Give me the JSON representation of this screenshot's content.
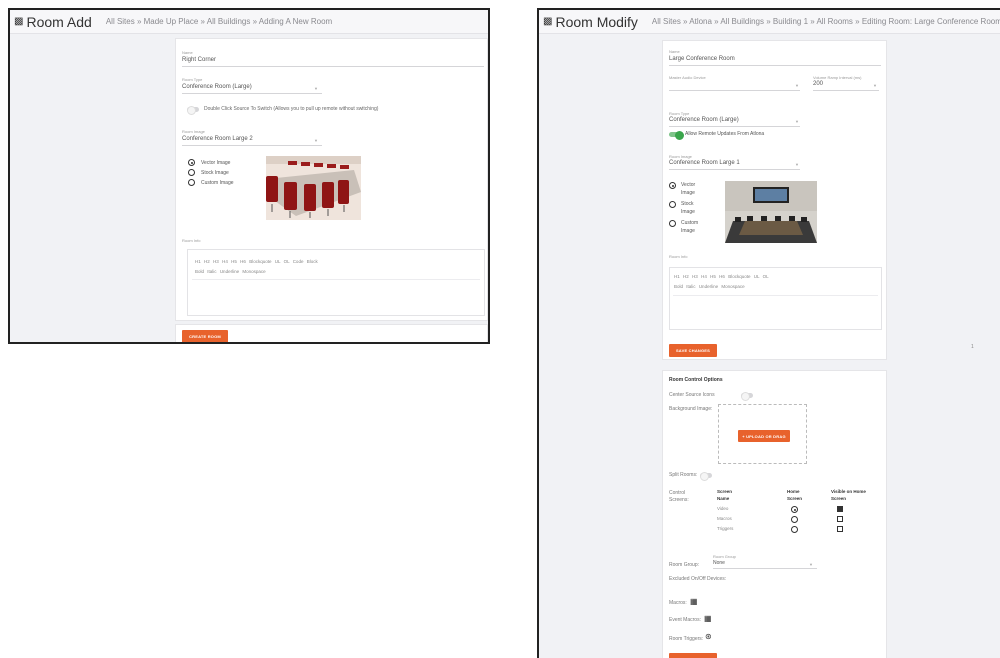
{
  "left": {
    "title": "Room Add",
    "breadcrumb": "All Sites » Made Up Place » All Buildings » Adding A New Room",
    "name_label": "Name",
    "name_value": "Right Corner",
    "room_type_label": "Room Type",
    "room_type_value": "Conference Room (Large)",
    "double_click_label": "Double Click Source To Switch (Allows you to pull up remote without switching)",
    "room_image_label": "Room Image",
    "room_image_value": "Conference Room Large 2",
    "image_options": [
      "Vector Image",
      "Stock Image",
      "Custom Image"
    ],
    "room_info_label": "Room Info",
    "toolbar_row1": [
      "H1",
      "H2",
      "H3",
      "H4",
      "H5",
      "H6",
      "Blockquote",
      "UL",
      "OL",
      "Code Block"
    ],
    "toolbar_row2": [
      "Bold",
      "Italic",
      "Underline",
      "Monospace"
    ],
    "create_button": "CREATE ROOM"
  },
  "right": {
    "title": "Room Modify",
    "breadcrumb": "All Sites » Atlona » All Buildings » Building 1 » All Rooms » Editing Room: Large Conference Room",
    "name_label": "Name",
    "name_value": "Large Conference Room",
    "master_audio_label": "Master Audio Device",
    "volume_label": "Volume Ramp Interval (ms)",
    "volume_value": "200",
    "room_type_label": "Room Type",
    "room_type_value": "Conference Room (Large)",
    "allow_remote_label": "Allow Remote Updates From Atlona",
    "room_image_label": "Room Image",
    "room_image_value": "Conference Room Large 1",
    "image_options": [
      "Vector Image",
      "Stock Image",
      "Custom Image"
    ],
    "room_info_label": "Room Info",
    "toolbar_row1": [
      "H1",
      "H2",
      "H3",
      "H4",
      "H5",
      "H6",
      "Blockquote",
      "UL",
      "OL"
    ],
    "toolbar_row2": [
      "Bold",
      "Italic",
      "Underline",
      "Monospace"
    ],
    "save_button": "SAVE CHANGES",
    "side_mark": "1",
    "control_title": "Room Control Options",
    "center_source_label": "Center Source Icons",
    "background_label": "Background Image:",
    "upload_button": "+ UPLOAD OR DRAG",
    "split_rooms_label": "Split Rooms:",
    "control_screens_label": "Control Screens:",
    "screens_headers": [
      "Screen Name",
      "Home Screen",
      "Visible on Home Screen"
    ],
    "screens": [
      {
        "name": "Video",
        "home": true,
        "visible": true
      },
      {
        "name": "Macros",
        "home": false,
        "visible": false
      },
      {
        "name": "Triggers",
        "home": false,
        "visible": false
      }
    ],
    "room_group_label": "Room Group:",
    "room_group_field_label": "Room Group",
    "room_group_value": "None",
    "excluded_label": "Excluded On/Off Devices:",
    "macros_label": "Macros:",
    "event_macros_label": "Event Macros:",
    "room_triggers_label": "Room Triggers:"
  }
}
